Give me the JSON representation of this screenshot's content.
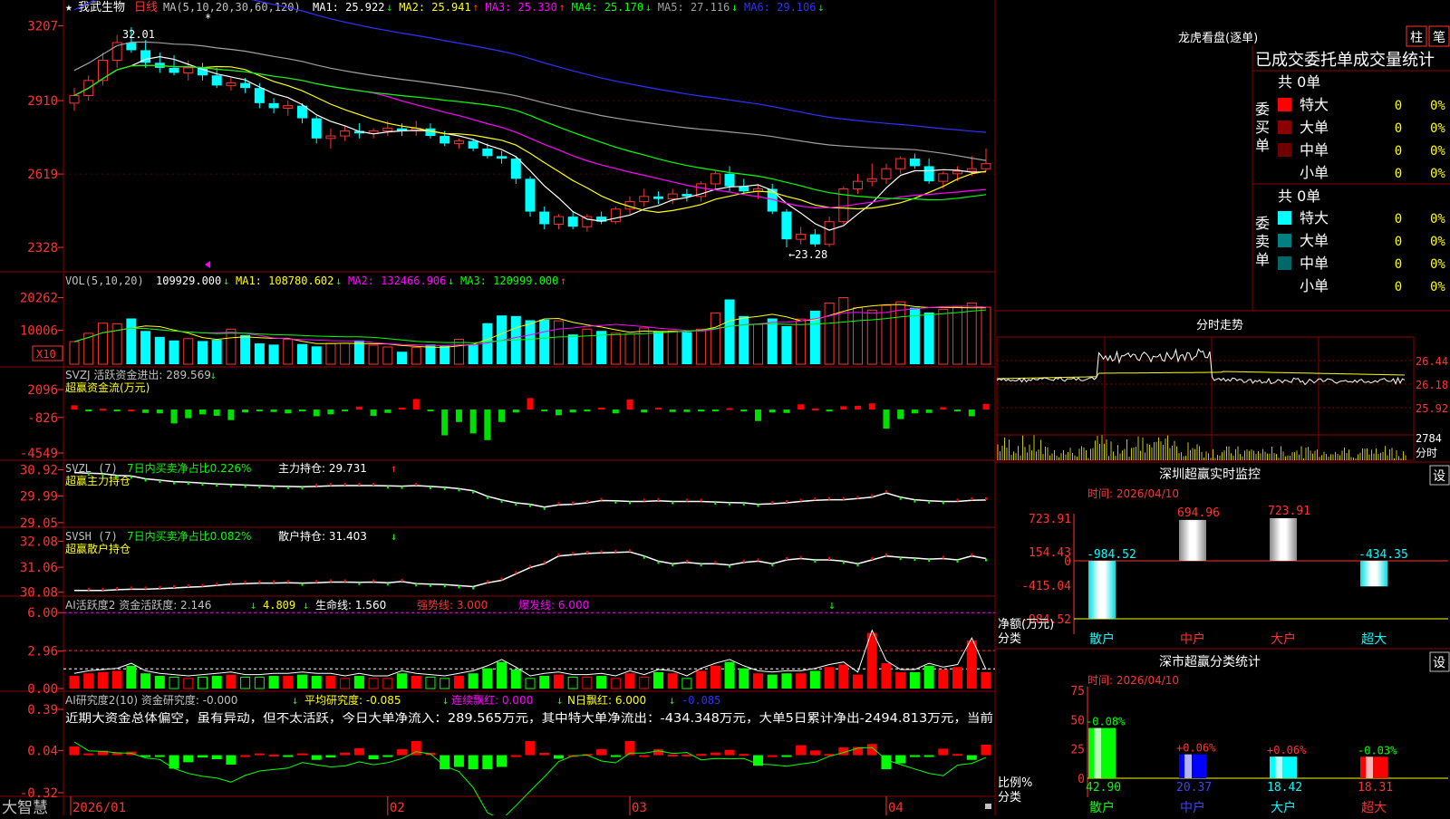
{
  "app": {
    "brand": "大智慧",
    "star": "★",
    "stock_name": "我武生物",
    "period_label": "日线"
  },
  "colors": {
    "up": "#ff3232",
    "down": "#00ffff",
    "grid": "#8b0000",
    "axis_text": "#ff3232",
    "ma1": "#ffffff",
    "ma2": "#ffff00",
    "ma3": "#ff00ff",
    "ma4": "#00ff00",
    "ma5": "#a0a0a0",
    "ma6": "#3030ff"
  },
  "header": {
    "ma_title": "MA(5,10,20,30,60,120)",
    "items": [
      {
        "label": "MA1: 25.922",
        "arrow": "↓",
        "color": "#ffffff"
      },
      {
        "label": "MA2: 25.941",
        "arrow": "↑",
        "color": "#ffff00"
      },
      {
        "label": "MA3: 25.330",
        "arrow": "↑",
        "color": "#ff00ff"
      },
      {
        "label": "MA4: 25.170",
        "arrow": "↓",
        "color": "#00ff00"
      },
      {
        "label": "MA5: 27.116",
        "arrow": "↓",
        "color": "#a0a0a0"
      },
      {
        "label": "MA6: 29.106",
        "arrow": "↓",
        "color": "#3030ff"
      }
    ]
  },
  "price_panel": {
    "y_ticks": [
      "3207",
      "2910",
      "2619",
      "2328"
    ],
    "high_label": "32.01",
    "low_label": "←23.28",
    "ylim": [
      22.6,
      32.3
    ]
  },
  "vol_panel": {
    "title": "VOL(5,10,20)",
    "items": [
      {
        "label": "109929.000",
        "arrow": "↓",
        "color": "#ffffff"
      },
      {
        "label": "MA1: 108780.602",
        "arrow": "↓",
        "color": "#ffff00"
      },
      {
        "label": "MA2: 132466.906",
        "arrow": "↓",
        "color": "#ff00ff"
      },
      {
        "label": "MA3: 120999.000",
        "arrow": "↑",
        "color": "#00ff00"
      }
    ],
    "y_ticks": [
      "20262",
      "10006"
    ],
    "unit": "X10"
  },
  "svzj_panel": {
    "title": "SVZJ  活跃资金进出: 289.569",
    "arrow": "↓",
    "subtitle": "超赢资金流(万元)",
    "y_ticks": [
      "2096",
      "-826",
      "-4549"
    ]
  },
  "svzl_panel": {
    "title": "SVZL (7)",
    "ratio_text": "7日内买卖净占比0.226%",
    "hold_text": "主力持仓: 29.731",
    "arrow": "↑",
    "subtitle": "超赢主力持仓",
    "y_ticks": [
      "30.92",
      "29.99",
      "29.05"
    ]
  },
  "svsh_panel": {
    "title": "SVSH (7)",
    "ratio_text": "7日内买卖净占比0.082%",
    "hold_text": "散户持仓: 31.403",
    "arrow": "↓",
    "subtitle": "超赢散户持仓",
    "y_ticks": [
      "32.08",
      "31.06",
      "30.08"
    ]
  },
  "ai1_panel": {
    "title": "AI活跃度2 资金活跃度: 2.146",
    "a1": "↓",
    "v2": "4.809",
    "a2": "↓",
    "life": "生命线: 1.560",
    "strong": "强势线: 3.000",
    "burst": "爆发线: 6.000",
    "y_ticks": [
      "6.00",
      "2.96",
      "0.00"
    ]
  },
  "ai2_panel": {
    "title": "AI研究度2(10) 资金研究度: -0.000",
    "a1": "↓",
    "avg": "平均研究度: -0.085",
    "a2": "↓",
    "hong": "连续飘红: 0.000",
    "a3": "↓",
    "nhong": "N日飘红: 6.000",
    "a4": "↓",
    "last": "-0.085",
    "commentary": "近期大资金总体偏空，虽有异动，但不太活跃，今日大单净流入：289.565万元，其中特大单净流出：-434.348万元，大单5日累计净出-2494.813万元，当前",
    "y_ticks": [
      "0.39",
      "0.04",
      "-0.32"
    ]
  },
  "x_axis": {
    "labels": [
      "2026/01",
      "02",
      "03",
      "04"
    ]
  },
  "longhu": {
    "title": "龙虎看盘(逐单)",
    "btn_a": "柱",
    "btn_b": "笔",
    "section_title": "已成交委托单成交量统计",
    "buy_label": [
      "委",
      "买",
      "单"
    ],
    "sell_label": [
      "委",
      "卖",
      "单"
    ],
    "buy_total": "共 0单",
    "sell_total": "共 0单",
    "buy_rows": [
      {
        "name": "特大",
        "count": "0",
        "pct": "0%",
        "color": "#ff0000"
      },
      {
        "name": "大单",
        "count": "0",
        "pct": "0%",
        "color": "#8b0000"
      },
      {
        "name": "中单",
        "count": "0",
        "pct": "0%",
        "color": "#700000"
      },
      {
        "name": "小单",
        "count": "0",
        "pct": "0%",
        "color": "#000000"
      }
    ],
    "sell_rows": [
      {
        "name": "特大",
        "count": "0",
        "pct": "0%",
        "color": "#00ffff"
      },
      {
        "name": "大单",
        "count": "0",
        "pct": "0%",
        "color": "#008080"
      },
      {
        "name": "中单",
        "count": "0",
        "pct": "0%",
        "color": "#006868"
      },
      {
        "name": "小单",
        "count": "0",
        "pct": "0%",
        "color": "#000000"
      }
    ]
  },
  "fenshi": {
    "title": "分时走势",
    "prices": [
      "26.44",
      "26.18",
      "25.92"
    ],
    "vol": "2784",
    "vol_unit": "分时"
  },
  "sz_monitor": {
    "title": "深圳超赢实时监控",
    "setting": "设",
    "time_label": "时间: 2026/04/10",
    "y_ticks": [
      "723.91",
      "154.43",
      "0",
      "-415.04",
      "-984.52"
    ],
    "axis_title": "净额(万元)",
    "axis_sub": "分类",
    "categories": [
      "散户",
      "中户",
      "大户",
      "超大"
    ],
    "values": [
      -984.52,
      694.96,
      723.91,
      -434.35
    ],
    "value_labels": [
      "-984.52",
      "694.96",
      "723.91",
      "-434.35"
    ]
  },
  "ss_stats": {
    "title": "深市超赢分类统计",
    "setting": "设",
    "time_label": "时间: 2026/04/10",
    "y_ticks": [
      "75",
      "50",
      "25",
      "0"
    ],
    "axis_title": "比例%",
    "axis_sub": "分类",
    "categories": [
      "散户",
      "中户",
      "大户",
      "超大"
    ],
    "values": [
      42.9,
      20.37,
      18.42,
      18.31
    ],
    "value_labels": [
      "42.90",
      "20.37",
      "18.42",
      "18.31"
    ],
    "changes": [
      "-0.08%",
      "+0.06%",
      "+0.06%",
      "-0.03%"
    ]
  },
  "chart_data": {
    "type": "candlestick",
    "title": "我武生物 日线",
    "x_labels": [
      "2026/01",
      "02",
      "03",
      "04"
    ],
    "ohlc": [
      [
        29.0,
        29.6,
        28.7,
        29.3
      ],
      [
        29.3,
        30.1,
        29.1,
        29.9
      ],
      [
        29.9,
        31.0,
        29.7,
        30.7
      ],
      [
        30.7,
        31.7,
        30.4,
        31.4
      ],
      [
        31.4,
        32.01,
        31.0,
        31.1
      ],
      [
        31.1,
        31.5,
        30.4,
        30.6
      ],
      [
        30.6,
        31.0,
        30.2,
        30.4
      ],
      [
        30.4,
        30.9,
        30.1,
        30.2
      ],
      [
        30.2,
        30.7,
        29.9,
        30.4
      ],
      [
        30.4,
        30.6,
        29.9,
        30.1
      ],
      [
        30.1,
        30.4,
        29.6,
        29.7
      ],
      [
        29.7,
        30.0,
        29.5,
        29.8
      ],
      [
        29.8,
        30.0,
        29.4,
        29.6
      ],
      [
        29.6,
        29.8,
        28.8,
        29.0
      ],
      [
        29.0,
        29.2,
        28.6,
        28.8
      ],
      [
        28.8,
        29.1,
        28.5,
        28.9
      ],
      [
        28.9,
        29.0,
        28.2,
        28.4
      ],
      [
        28.4,
        28.5,
        27.4,
        27.6
      ],
      [
        27.6,
        28.0,
        27.2,
        27.7
      ],
      [
        27.7,
        28.1,
        27.5,
        27.9
      ],
      [
        27.9,
        28.2,
        27.6,
        27.8
      ],
      [
        27.8,
        28.0,
        27.6,
        27.9
      ],
      [
        27.9,
        28.3,
        27.7,
        28.0
      ],
      [
        28.0,
        28.2,
        27.7,
        27.9
      ],
      [
        27.9,
        28.3,
        27.7,
        28.0
      ],
      [
        28.0,
        28.2,
        27.6,
        27.7
      ],
      [
        27.7,
        27.9,
        27.3,
        27.4
      ],
      [
        27.4,
        27.6,
        27.2,
        27.5
      ],
      [
        27.5,
        27.6,
        27.1,
        27.2
      ],
      [
        27.2,
        27.4,
        26.8,
        26.9
      ],
      [
        26.9,
        27.1,
        26.6,
        26.8
      ],
      [
        26.8,
        26.9,
        25.8,
        26.0
      ],
      [
        26.0,
        26.1,
        24.5,
        24.7
      ],
      [
        24.7,
        24.9,
        24.0,
        24.2
      ],
      [
        24.2,
        24.6,
        24.0,
        24.5
      ],
      [
        24.5,
        24.7,
        24.0,
        24.1
      ],
      [
        24.1,
        24.6,
        23.9,
        24.5
      ],
      [
        24.5,
        24.7,
        24.2,
        24.3
      ],
      [
        24.3,
        24.9,
        24.2,
        24.8
      ],
      [
        24.8,
        25.3,
        24.6,
        25.1
      ],
      [
        25.1,
        25.6,
        24.9,
        25.3
      ],
      [
        25.3,
        25.5,
        25.0,
        25.2
      ],
      [
        25.2,
        25.6,
        25.0,
        25.4
      ],
      [
        25.4,
        25.6,
        25.1,
        25.3
      ],
      [
        25.3,
        25.9,
        25.1,
        25.8
      ],
      [
        25.8,
        26.3,
        25.6,
        26.2
      ],
      [
        26.2,
        26.5,
        25.5,
        25.7
      ],
      [
        25.7,
        26.0,
        25.4,
        25.5
      ],
      [
        25.5,
        25.8,
        25.2,
        25.6
      ],
      [
        25.6,
        25.8,
        24.6,
        24.7
      ],
      [
        24.7,
        24.8,
        23.28,
        23.6
      ],
      [
        23.6,
        24.1,
        23.4,
        23.8
      ],
      [
        23.8,
        24.0,
        23.3,
        23.4
      ],
      [
        23.4,
        24.5,
        23.3,
        24.3
      ],
      [
        24.3,
        25.7,
        24.2,
        25.6
      ],
      [
        25.6,
        26.2,
        25.4,
        25.9
      ],
      [
        25.9,
        26.6,
        25.7,
        26.0
      ],
      [
        26.0,
        26.6,
        25.8,
        26.4
      ],
      [
        26.4,
        26.9,
        26.2,
        26.8
      ],
      [
        26.8,
        27.0,
        26.4,
        26.5
      ],
      [
        26.5,
        26.8,
        25.8,
        25.9
      ],
      [
        25.9,
        26.3,
        25.6,
        26.2
      ],
      [
        26.2,
        26.5,
        25.9,
        26.3
      ],
      [
        26.3,
        26.9,
        26.1,
        26.4
      ],
      [
        26.4,
        27.2,
        26.3,
        26.6
      ]
    ],
    "volume": [
      3800,
      5200,
      6900,
      6800,
      7700,
      5600,
      4600,
      4000,
      4300,
      3900,
      4100,
      5900,
      4900,
      3500,
      3300,
      4200,
      3400,
      3000,
      3500,
      3500,
      4000,
      3200,
      2900,
      2100,
      2800,
      3300,
      3100,
      4200,
      3300,
      6900,
      8200,
      8100,
      7400,
      7500,
      7300,
      5000,
      5900,
      5600,
      5200,
      5100,
      6100,
      5500,
      5600,
      5400,
      5900,
      8600,
      10900,
      8100,
      6700,
      7700,
      6400,
      7600,
      9000,
      10300,
      11200,
      9500,
      9100,
      9900,
      10500,
      9500,
      8700,
      9200,
      9700,
      10300,
      9600
    ],
    "fund_flow_wan": [
      450,
      -150,
      80,
      -60,
      0,
      -350,
      -400,
      -1450,
      -900,
      -500,
      -650,
      -1100,
      -300,
      -150,
      -250,
      -400,
      -150,
      -700,
      -500,
      -80,
      300,
      -650,
      -350,
      200,
      1100,
      -100,
      -2700,
      -1300,
      -2500,
      -3200,
      -1300,
      -300,
      1200,
      -100,
      -600,
      -300,
      -200,
      200,
      -400,
      1050,
      -300,
      200,
      -250,
      -250,
      -200,
      -80,
      150,
      -200,
      -1200,
      -300,
      -350,
      550,
      100,
      -200,
      350,
      400,
      650,
      -2000,
      -1000,
      -400,
      -350,
      250,
      -200,
      -700,
      600
    ],
    "zhuli_hold": [
      30.82,
      30.8,
      30.78,
      30.72,
      30.7,
      30.6,
      30.55,
      30.5,
      30.48,
      30.45,
      30.42,
      30.4,
      30.38,
      30.36,
      30.34,
      30.33,
      30.32,
      30.33,
      30.35,
      30.36,
      30.36,
      30.36,
      30.35,
      30.34,
      30.36,
      30.33,
      30.3,
      30.25,
      30.18,
      29.98,
      29.85,
      29.75,
      29.7,
      29.6,
      29.68,
      29.7,
      29.75,
      29.83,
      29.82,
      29.8,
      29.8,
      29.82,
      29.8,
      29.8,
      29.8,
      29.78,
      29.76,
      29.75,
      29.7,
      29.72,
      29.75,
      29.8,
      29.84,
      29.86,
      29.86,
      29.9,
      29.95,
      30.1,
      29.95,
      29.86,
      29.82,
      29.8,
      29.8,
      29.84,
      29.85
    ],
    "sanhu_hold": [
      30.15,
      30.15,
      30.15,
      30.18,
      30.2,
      30.2,
      30.22,
      30.25,
      30.28,
      30.3,
      30.35,
      30.4,
      30.42,
      30.44,
      30.44,
      30.45,
      30.44,
      30.45,
      30.48,
      30.48,
      30.47,
      30.48,
      30.45,
      30.5,
      30.42,
      30.4,
      30.38,
      30.34,
      30.3,
      30.45,
      30.55,
      30.8,
      31.05,
      31.2,
      31.5,
      31.55,
      31.6,
      31.62,
      31.64,
      31.66,
      31.5,
      31.3,
      31.2,
      31.25,
      31.2,
      31.2,
      31.15,
      31.25,
      31.3,
      31.2,
      31.35,
      31.4,
      31.35,
      31.35,
      31.3,
      31.2,
      31.35,
      31.5,
      31.45,
      31.42,
      31.38,
      31.4,
      31.35,
      31.5,
      31.4
    ],
    "activity": [
      1.0,
      1.2,
      1.3,
      1.4,
      1.8,
      1.2,
      1.0,
      0.9,
      0.8,
      0.9,
      1.0,
      1.1,
      0.9,
      0.9,
      1.0,
      1.0,
      1.1,
      1.0,
      1.0,
      0.8,
      1.0,
      0.8,
      0.8,
      1.2,
      1.0,
      0.9,
      0.8,
      1.0,
      1.2,
      1.6,
      2.1,
      1.5,
      0.8,
      1.0,
      1.1,
      0.9,
      0.9,
      1.0,
      0.8,
      1.2,
      0.9,
      1.3,
      1.2,
      0.8,
      1.4,
      1.8,
      2.1,
      1.6,
      1.2,
      1.1,
      1.2,
      1.2,
      1.4,
      1.7,
      1.9,
      1.1,
      4.4,
      2.0,
      1.3,
      1.3,
      1.8,
      1.5,
      1.7,
      3.8,
      1.3
    ]
  }
}
